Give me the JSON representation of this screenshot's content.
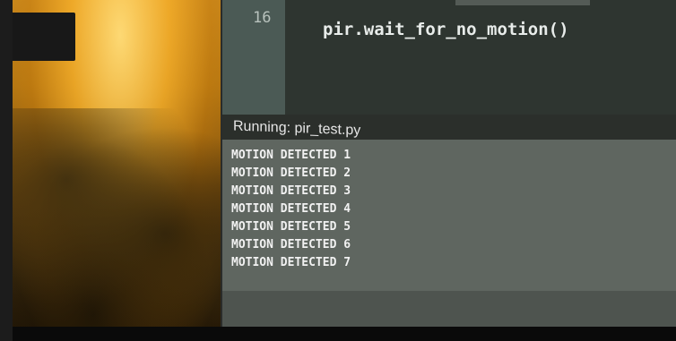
{
  "editor": {
    "line_number": "16",
    "code": "pir.wait_for_no_motion()"
  },
  "status": {
    "text": "Running: pir_test.py"
  },
  "console": {
    "lines": [
      "MOTION DETECTED 1",
      "MOTION DETECTED 2",
      "MOTION DETECTED 3",
      "MOTION DETECTED 4",
      "MOTION DETECTED 5",
      "MOTION DETECTED 6",
      "MOTION DETECTED 7"
    ]
  }
}
